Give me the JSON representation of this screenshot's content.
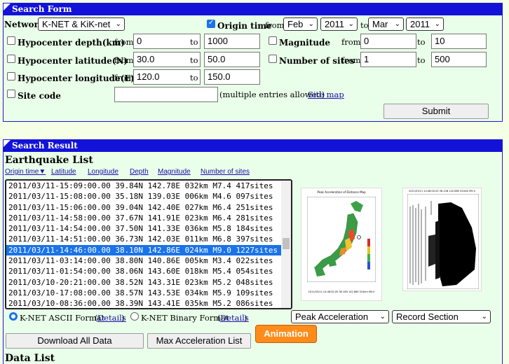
{
  "search_form": {
    "title": "Search Form",
    "network_label": "Network",
    "network_value": "K-NET & KiK-net",
    "origin_time": {
      "label": "Origin time",
      "from_label": "from",
      "to_label": "to",
      "from_month": "Feb",
      "from_year": "2011",
      "to_month": "Mar",
      "to_year": "2011",
      "checked": true
    },
    "depth": {
      "label": "Hypocenter depth(km)",
      "from_label": "from",
      "to_label": "to",
      "from": "0",
      "to": "1000"
    },
    "latitude": {
      "label": "Hypocenter latitude(N)",
      "from_label": "from",
      "to_label": "to",
      "from": "30.0",
      "to": "50.0"
    },
    "longitude": {
      "label": "Hypocenter longitude(E)",
      "from_label": "from",
      "to_label": "to",
      "from": "120.0",
      "to": "150.0"
    },
    "magnitude": {
      "label": "Magnitude",
      "from_label": "from",
      "to_label": "to",
      "from": "0",
      "to": "10"
    },
    "sites": {
      "label": "Number of sites",
      "from_label": "from",
      "to_label": "to",
      "from": "1",
      "to": "500"
    },
    "site_code": {
      "label": "Site code",
      "value": "",
      "note": "(multiple entries allowed)",
      "map_link": "Site map"
    },
    "submit_label": "Submit"
  },
  "search_result": {
    "title": "Search Result",
    "list_title": "Earthquake List",
    "columns": [
      "Origin time▼",
      "Latitude",
      "Longitude",
      "Depth",
      "Magnitude",
      "Number of sites"
    ],
    "rows": [
      "2011/03/11-15:09:00.00 39.84N 142.78E 032km M7.4 417sites",
      "2011/03/11-15:08:00.00 35.18N 139.03E 006km M4.6 097sites",
      "2011/03/11-15:06:00.00 39.04N 142.40E 027km M6.4 251sites",
      "2011/03/11-14:58:00.00 37.67N 141.91E 023km M6.4 281sites",
      "2011/03/11-14:54:00.00 37.50N 141.33E 036km M5.8 184sites",
      "2011/03/11-14:51:00.00 36.73N 142.03E 011km M6.8 397sites",
      "2011/03/11-14:46:00.00 38.10N 142.86E 024km M9.0 1227sites",
      "2011/03/11-03:14:00.00 38.80N 140.86E 005km M3.4 022sites",
      "2011/03/11-01:54:00.00 38.06N 143.60E 018km M5.4 054sites",
      "2011/03/10-20:21:00.00 38.52N 143.31E 023km M5.2 048sites",
      "2011/03/10-17:08:00.00 38.57N 143.53E 034km M5.9 109sites",
      "2011/03/10-08:36:00.00 38.39N 143.41E 035km M5.2 086sites"
    ],
    "selected_index": 6,
    "map_caption": "Peak Acceleration of Distance Map",
    "map_footer": "2011/03/11-14:46:00.00 38.10N 142.86E 024km M9.0",
    "section_caption": "2011/03/11 14:46:00.00 38.10N 142.86E 024km M9.0",
    "format_ascii": "K-NET ASCII Format",
    "format_binary": "K-NET Binary Format",
    "details": "Details",
    "map_select": "Peak Acceleration",
    "section_select": "Record Section",
    "download_all": "Download All Data",
    "max_accel": "Max Acceleration List",
    "animation": "Animation",
    "data_list": "Data List"
  }
}
